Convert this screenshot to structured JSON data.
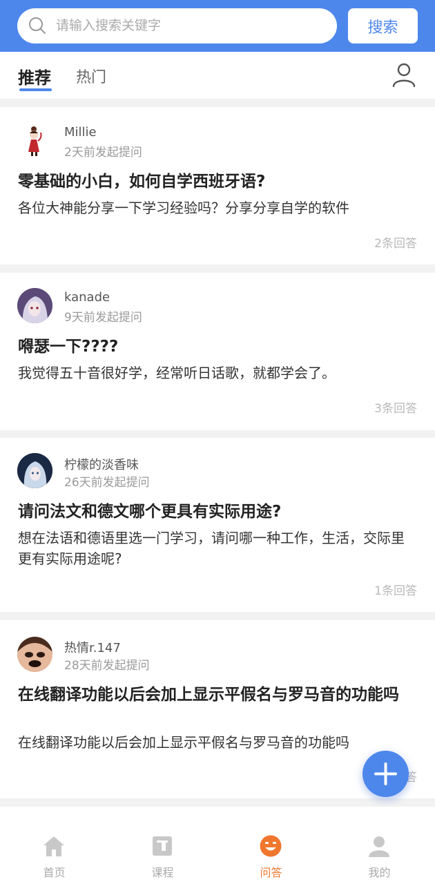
{
  "search": {
    "placeholder": "请输入搜索关键字",
    "button": "搜索"
  },
  "tabs": [
    {
      "label": "推荐",
      "active": true
    },
    {
      "label": "热门",
      "active": false
    }
  ],
  "posts": [
    {
      "username": "Millie",
      "time": "2天前发起提问",
      "title": "零基础的小白，如何自学西班牙语?",
      "body": "各位大神能分享一下学习经验吗？分享分享自学的软件",
      "answers": "2条回答"
    },
    {
      "username": "kanade",
      "time": "9天前发起提问",
      "title": "嘚瑟一下????",
      "body": "我觉得五十音很好学，经常听日话歌，就都学会了。",
      "answers": "3条回答"
    },
    {
      "username": "柠檬的淡香味",
      "time": "26天前发起提问",
      "title": "请问法文和德文哪个更具有实际用途?",
      "body": "想在法语和德语里选一门学习，请问哪一种工作，生活，交际里更有实际用途呢?",
      "answers": "1条回答"
    },
    {
      "username": "热情r.147",
      "time": "28天前发起提问",
      "title": "在线翻译功能以后会加上显示平假名与罗马音的功能吗",
      "body": "在线翻译功能以后会加上显示平假名与罗马音的功能吗",
      "answers": "条回答"
    }
  ],
  "nav": [
    {
      "label": "首页",
      "icon": "home-icon"
    },
    {
      "label": "课程",
      "icon": "course-icon"
    },
    {
      "label": "问答",
      "icon": "qa-icon",
      "active": true
    },
    {
      "label": "我的",
      "icon": "user-icon"
    }
  ],
  "colors": {
    "accent": "#4d87ec",
    "active_nav": "#f0772e"
  }
}
